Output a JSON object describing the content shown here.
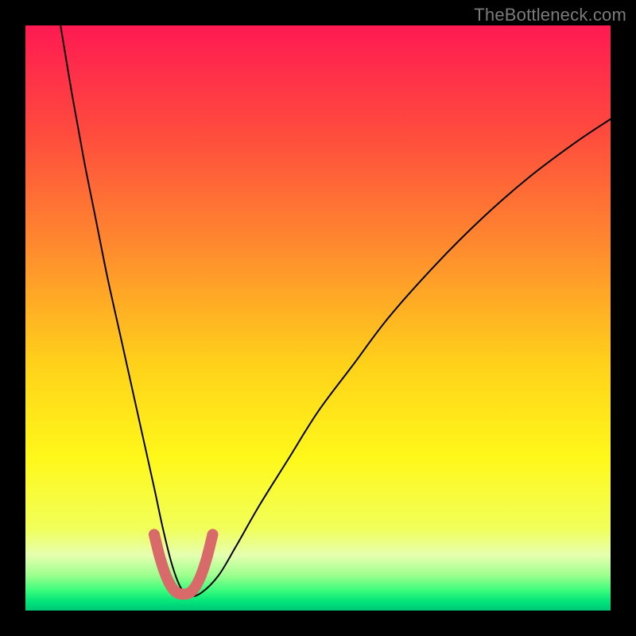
{
  "watermark": "TheBottleneck.com",
  "chart_data": {
    "type": "line",
    "title": "",
    "xlabel": "",
    "ylabel": "",
    "xlim": [
      0,
      100
    ],
    "ylim": [
      0,
      100
    ],
    "grid": false,
    "legend": false,
    "gradient_stops": [
      {
        "offset": 0,
        "color": "#ff1a52"
      },
      {
        "offset": 0.18,
        "color": "#ff4a3e"
      },
      {
        "offset": 0.38,
        "color": "#ff8b2e"
      },
      {
        "offset": 0.58,
        "color": "#ffd21a"
      },
      {
        "offset": 0.74,
        "color": "#fff81a"
      },
      {
        "offset": 0.86,
        "color": "#f1ff5a"
      },
      {
        "offset": 0.905,
        "color": "#e6ffb0"
      },
      {
        "offset": 0.94,
        "color": "#9cff8e"
      },
      {
        "offset": 0.965,
        "color": "#3dfc7c"
      },
      {
        "offset": 0.985,
        "color": "#00e47a"
      },
      {
        "offset": 1.0,
        "color": "#00c878"
      }
    ],
    "series": [
      {
        "name": "bottleneck-curve",
        "color": "#000000",
        "stroke_width": 2,
        "x": [
          6,
          8,
          10,
          12,
          14,
          16,
          18,
          20,
          22,
          23.5,
          25,
          26.5,
          28,
          30,
          33,
          36,
          40,
          45,
          50,
          56,
          62,
          70,
          78,
          86,
          94,
          100
        ],
        "y": [
          100,
          88,
          77,
          67,
          57,
          48,
          39,
          30,
          21,
          14,
          8,
          4,
          2.5,
          3,
          6,
          11,
          18,
          26,
          34,
          42,
          50,
          59,
          67,
          74,
          80,
          84
        ]
      },
      {
        "name": "valley-highlight",
        "color": "#d86a6a",
        "stroke_width": 14,
        "linecap": "round",
        "x": [
          22,
          23,
          24,
          25,
          26,
          27,
          28,
          29,
          30,
          31,
          32
        ],
        "y": [
          13,
          9,
          6,
          4,
          3,
          2.8,
          3,
          4,
          6,
          9,
          13
        ]
      }
    ]
  }
}
